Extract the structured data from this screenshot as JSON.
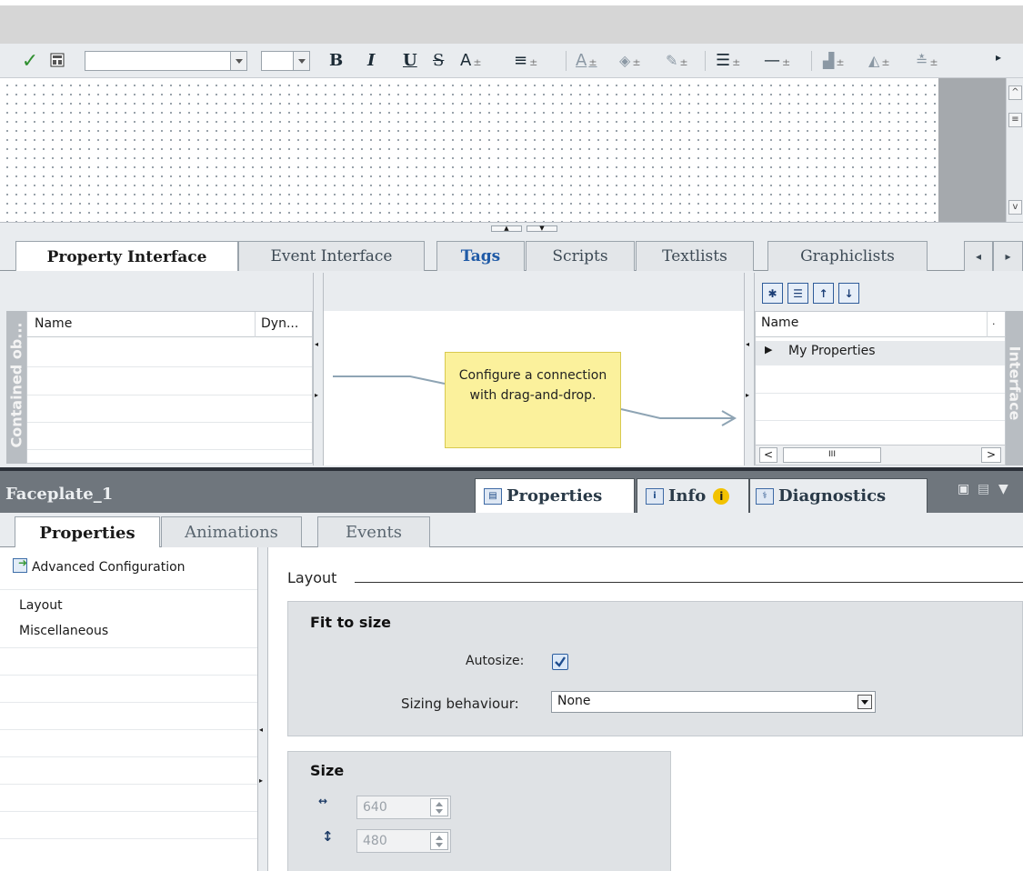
{
  "toolbar": {
    "font_combo_value": "",
    "size_combo_value": "",
    "bold_label": "B",
    "italic_label": "I",
    "underline_label": "U",
    "strike_label": "S",
    "fontsize_label": "A",
    "align_label": "≡",
    "fontcolor_label": "A",
    "overflow_label": "▸"
  },
  "editor": {
    "splitter_up": "▲",
    "splitter_down": "▼"
  },
  "interface_tabs": [
    {
      "label": "Property Interface",
      "active": true
    },
    {
      "label": "Event Interface",
      "active": false
    },
    {
      "label": "Tags",
      "active": false,
      "highlight": true
    },
    {
      "label": "Scripts",
      "active": false
    },
    {
      "label": "Textlists",
      "active": false
    },
    {
      "label": "Graphiclists",
      "active": false
    }
  ],
  "tab_nav": {
    "prev": "◂",
    "next": "▸"
  },
  "left_panel": {
    "vertical_label": "Contained ob...",
    "col_name": "Name",
    "col_dyn": "Dyn..."
  },
  "connection_hint": "Configure a connection with drag-and-drop.",
  "right_panel": {
    "vertical_label": "Interface",
    "col_name": "Name",
    "col_extra": ".",
    "rows": [
      "My Properties"
    ],
    "hscroll_left": "<",
    "hscroll_mid": "III",
    "hscroll_right": ">"
  },
  "inspector": {
    "object_name": "Faceplate_1",
    "tabs": [
      {
        "label": "Properties",
        "selected": true
      },
      {
        "label": "Info",
        "selected": false
      },
      {
        "label": "Diagnostics",
        "selected": false
      }
    ],
    "info_badge": "i"
  },
  "property_tabs": [
    {
      "label": "Properties",
      "active": true
    },
    {
      "label": "Animations",
      "active": false
    },
    {
      "label": "Events",
      "active": false
    }
  ],
  "nav": {
    "header": "Advanced Configuration",
    "items": [
      "Layout",
      "Miscellaneous"
    ]
  },
  "layout": {
    "section_title": "Layout",
    "fit_title": "Fit to size",
    "autosize_label": "Autosize:",
    "autosize_checked": true,
    "sizing_label": "Sizing behaviour:",
    "sizing_value": "None",
    "size_title": "Size",
    "width_value": "640",
    "height_value": "480"
  }
}
